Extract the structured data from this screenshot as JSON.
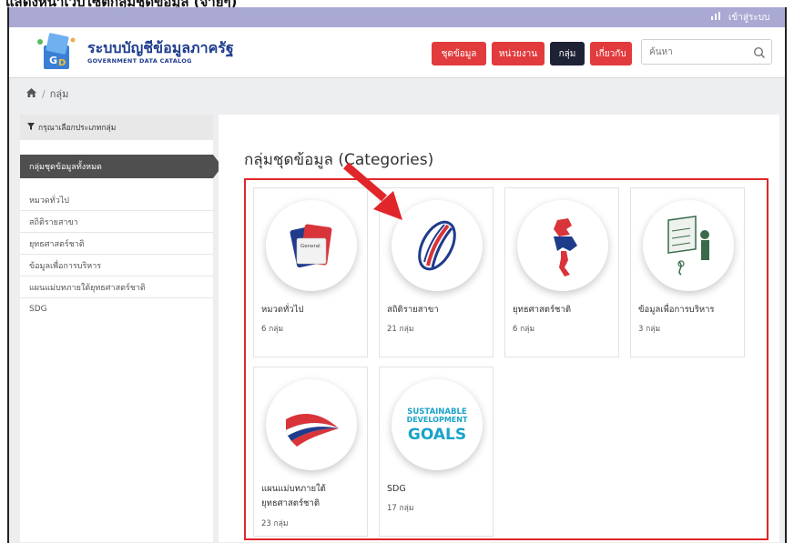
{
  "cutoff_text": "แสดงหน้าเว็บไซต์กลุ่มชุดข้อมูล (จ่ายๆ)",
  "topbar": {
    "icon": "chart-icon",
    "login": "เข้าสู่ระบบ"
  },
  "brand": {
    "title_th": "ระบบบัญชีข้อมูลภาครัฐ",
    "title_en": "GOVERNMENT DATA CATALOG",
    "logo": "gdc-logo"
  },
  "nav": {
    "items": [
      {
        "label": "ชุดข้อมูล",
        "active": false
      },
      {
        "label": "หน่วยงาน",
        "active": false
      },
      {
        "label": "กลุ่ม",
        "active": true
      },
      {
        "label": "เกี่ยวกับ",
        "active": false
      }
    ]
  },
  "search": {
    "placeholder": "ค้นหา",
    "icon": "search-icon"
  },
  "breadcrumb": {
    "home_icon": "home-icon",
    "current": "กลุ่ม"
  },
  "sidebar": {
    "heading": "กรุณาเลือกประเภทกลุ่ม",
    "filter_icon": "filter-icon",
    "active": "กลุ่มชุดข้อมูลทั้งหมด",
    "items": [
      "หมวดทั่วไป",
      "สถิติรายสาขา",
      "ยุทธศาสตร์ชาติ",
      "ข้อมูลเพื่อการบริหาร",
      "แผนแม่บทภายใต้ยุทธศาสตร์ชาติ",
      "SDG"
    ]
  },
  "main": {
    "title": "กลุ่มชุดข้อมูล (Categories)",
    "cards": [
      {
        "name": "หมวดทั่วไป",
        "count": "6 กลุ่ม",
        "icon": "general-icon",
        "icon_text": "General"
      },
      {
        "name": "สถิติรายสาขา",
        "count": "21 กลุ่ม",
        "icon": "statistics-icon"
      },
      {
        "name": "ยุทธศาสตร์ชาติ",
        "count": "6 กลุ่ม",
        "icon": "thailand-map-icon"
      },
      {
        "name": "ข้อมูลเพื่อการบริหาร",
        "count": "3 กลุ่ม",
        "icon": "management-icon"
      },
      {
        "name": "แผนแม่บทภายใต้ยุทธศาสตร์ชาติ",
        "count": "23 กลุ่ม",
        "icon": "thai-flag-wave-icon"
      },
      {
        "name": "SDG",
        "count": "17 กลุ่ม",
        "icon": "sdg-icon",
        "icon_text": [
          "SUSTAINABLE",
          "DEVELOPMENT",
          "GOALS"
        ]
      }
    ]
  },
  "colors": {
    "accent": "#e23b3d",
    "nav_active": "#1d2235",
    "topbar": "#a9a9d4",
    "highlight_box": "#e0262a",
    "brand_blue": "#1e3c8e"
  },
  "annotation": {
    "icon": "red-arrow-icon"
  }
}
